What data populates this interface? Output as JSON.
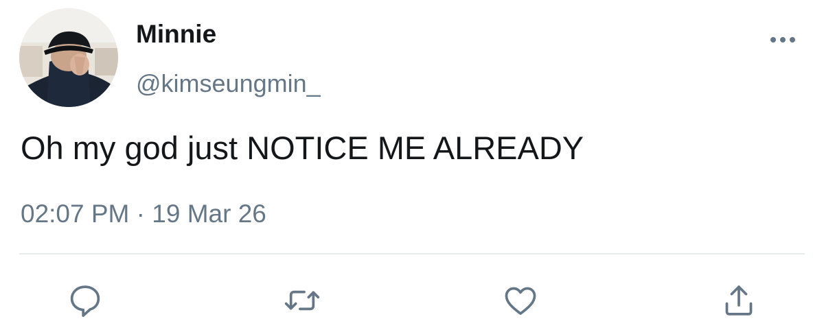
{
  "user": {
    "display_name": "Minnie",
    "handle": "@kimseungmin_",
    "avatar_icon": "profile-photo"
  },
  "tweet": {
    "text": "Oh my god just NOTICE ME ALREADY",
    "time": "02:07 PM",
    "separator": "·",
    "date": "19 Mar 26"
  },
  "actions": [
    {
      "icon": "reply-icon"
    },
    {
      "icon": "retweet-icon"
    },
    {
      "icon": "like-icon"
    },
    {
      "icon": "share-icon"
    }
  ],
  "colors": {
    "text": "#14171a",
    "secondary": "#657786",
    "divider": "#e6ecf0"
  }
}
